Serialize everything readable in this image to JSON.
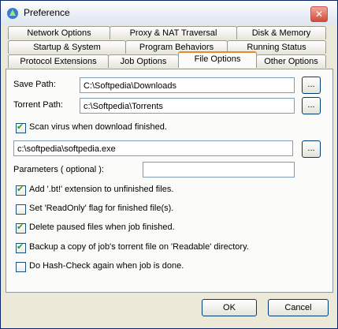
{
  "window": {
    "title": "Preference"
  },
  "tabs": {
    "row1": [
      "Network Options",
      "Proxy & NAT Traversal",
      "Disk & Memory"
    ],
    "row2": [
      "Startup & System",
      "Program Behaviors",
      "Running Status"
    ],
    "row3": [
      "Protocol Extensions",
      "Job Options",
      "File Options",
      "Other Options"
    ],
    "active": "File Options"
  },
  "form": {
    "save_path_label": "Save Path:",
    "save_path_value": "C:\\Softpedia\\Downloads",
    "torrent_path_label": "Torrent Path:",
    "torrent_path_value": "c:\\Softpedia\\Torrents",
    "browse_label": "...",
    "scan_virus_label": "Scan virus when download finished.",
    "scanner_path_value": "c:\\softpedia\\softpedia.exe",
    "parameters_label": "Parameters ( optional ):",
    "parameters_value": "",
    "options": [
      {
        "label": "Add '.bt!' extension to unfinished files.",
        "checked": true
      },
      {
        "label": "Set 'ReadOnly' flag for finished file(s).",
        "checked": false
      },
      {
        "label": "Delete paused files when job finished.",
        "checked": true
      },
      {
        "label": "Backup a copy of job's torrent file on 'Readable' directory.",
        "checked": true
      },
      {
        "label": "Do Hash-Check again when job is done.",
        "checked": false
      }
    ],
    "scan_virus_checked": true
  },
  "buttons": {
    "ok": "OK",
    "cancel": "Cancel"
  }
}
